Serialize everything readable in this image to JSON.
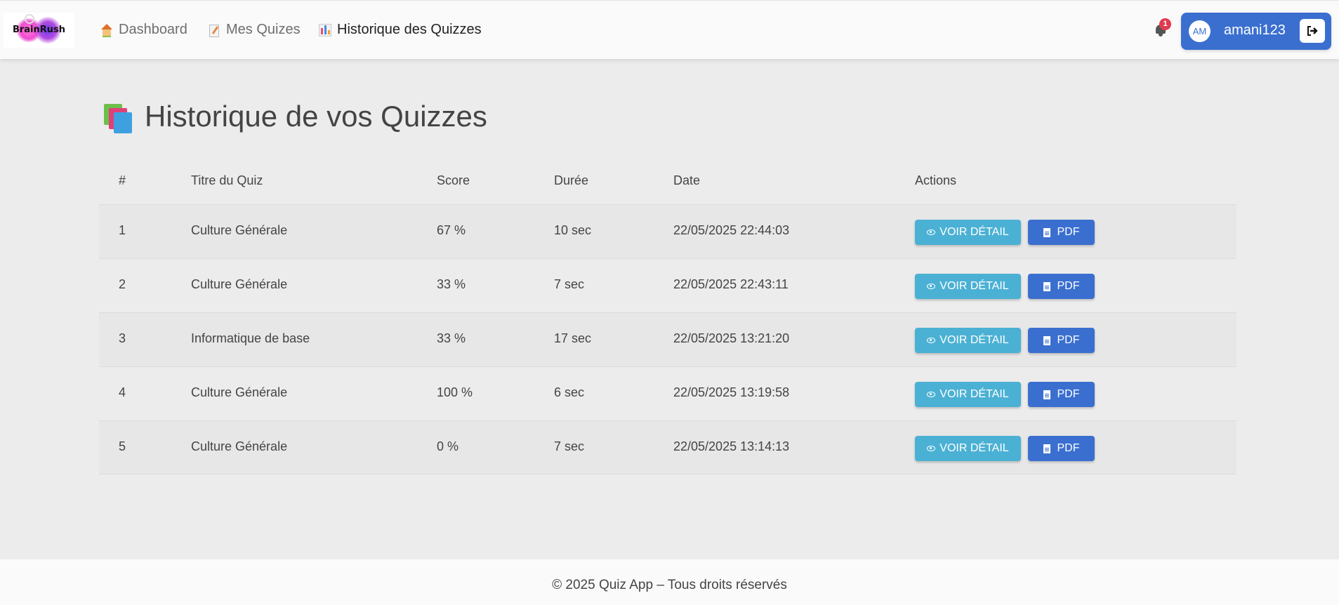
{
  "brand": {
    "logo_text": "BrainRush"
  },
  "nav": {
    "items": [
      {
        "label": "Dashboard",
        "icon": "house-icon"
      },
      {
        "label": "Mes Quizes",
        "icon": "memo-icon"
      },
      {
        "label": "Historique des Quizzes",
        "icon": "bar-chart-icon",
        "active": true
      }
    ]
  },
  "notifications": {
    "count": "1"
  },
  "user": {
    "initials": "AM",
    "username": "amani123"
  },
  "page": {
    "title": "Historique de vos Quizzes"
  },
  "table": {
    "headers": [
      "#",
      "Titre du Quiz",
      "Score",
      "Durée",
      "Date",
      "Actions"
    ],
    "rows": [
      {
        "num": "1",
        "title": "Culture Générale",
        "score": "67 %",
        "duration": "10 sec",
        "date": "22/05/2025 22:44:03"
      },
      {
        "num": "2",
        "title": "Culture Générale",
        "score": "33 %",
        "duration": "7 sec",
        "date": "22/05/2025 22:43:11"
      },
      {
        "num": "3",
        "title": "Informatique de base",
        "score": "33 %",
        "duration": "17 sec",
        "date": "22/05/2025 13:21:20"
      },
      {
        "num": "4",
        "title": "Culture Générale",
        "score": "100 %",
        "duration": "6 sec",
        "date": "22/05/2025 13:19:58"
      },
      {
        "num": "5",
        "title": "Culture Générale",
        "score": "0 %",
        "duration": "7 sec",
        "date": "22/05/2025 13:14:13"
      }
    ],
    "actions": {
      "view_label": "VOIR DÉTAIL",
      "pdf_label": "PDF"
    }
  },
  "footer": {
    "text": "© 2025 Quiz App – Tous droits réservés"
  },
  "colors": {
    "primary": "#3a6fd0",
    "info": "#4bb1d4",
    "badge": "#e03b4f",
    "background": "#ececec"
  }
}
